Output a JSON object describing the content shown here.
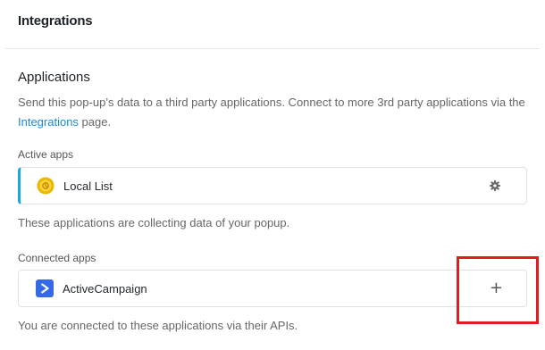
{
  "header": {
    "title": "Integrations"
  },
  "applications": {
    "title": "Applications",
    "description_prefix": "Send this pop-up’s data to a third party applications. Connect to more 3rd party applications via the ",
    "description_link": "Integrations",
    "description_suffix": " page."
  },
  "active_apps": {
    "label": "Active apps",
    "items": [
      {
        "name": "Local List",
        "icon": "local-list-icon",
        "action_icon": "gear-icon"
      }
    ],
    "note": "These applications are collecting data of your popup."
  },
  "connected_apps": {
    "label": "Connected apps",
    "items": [
      {
        "name": "ActiveCampaign",
        "icon": "activecampaign-icon",
        "action_icon": "plus-icon",
        "action_label": "+"
      }
    ],
    "note": "You are connected to these applications via their APIs."
  },
  "colors": {
    "accent": "#17a8e3",
    "link": "#1a8ad8",
    "highlight": "#e01b22"
  }
}
